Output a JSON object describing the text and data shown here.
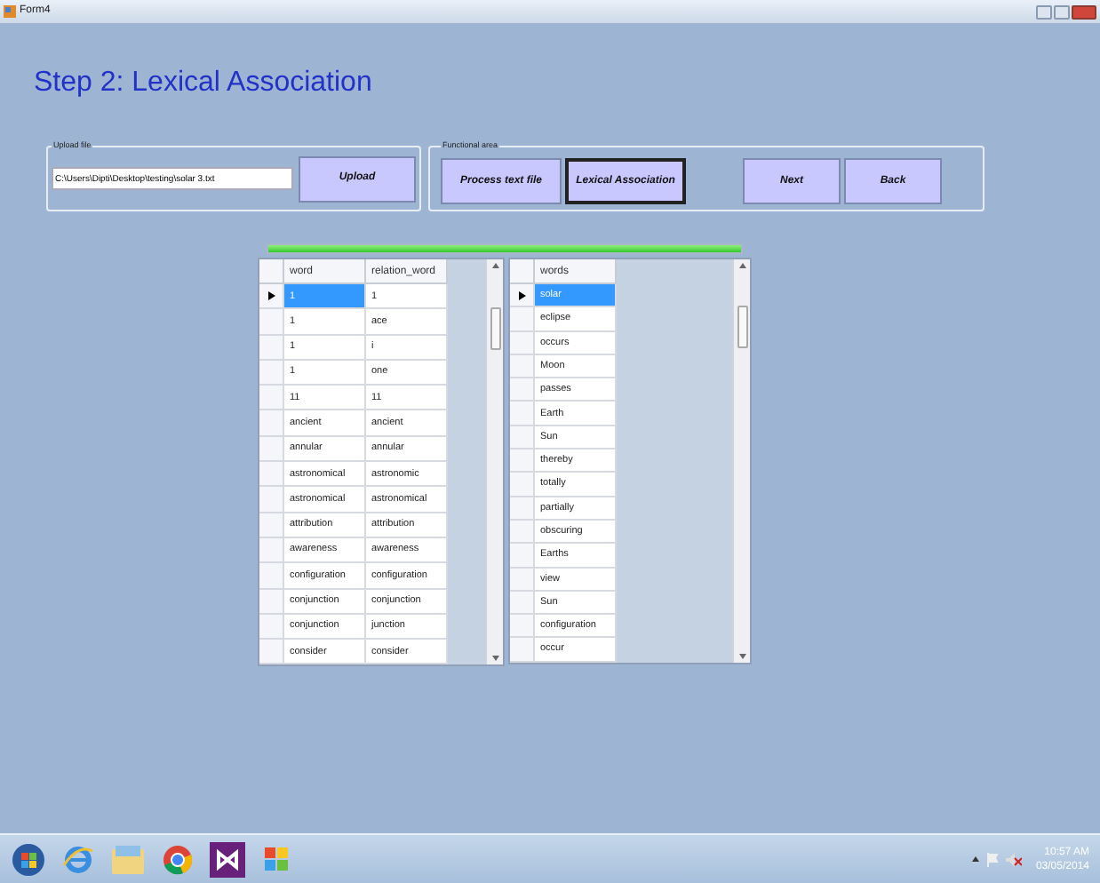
{
  "window": {
    "title": "Form4"
  },
  "heading": "Step 2:  Lexical Association",
  "upload_group": {
    "label": "Upload file",
    "path": "C:\\Users\\Dipti\\Desktop\\testing\\solar 3.txt",
    "button": "Upload"
  },
  "functional_group": {
    "label": "Functional area",
    "buttons": [
      {
        "label": "Process text file",
        "selected": false
      },
      {
        "label": "Lexical Association",
        "selected": true
      },
      {
        "label": "Next",
        "selected": false
      },
      {
        "label": "Back",
        "selected": false
      }
    ]
  },
  "progress": {
    "level": 1
  },
  "left_table": {
    "columns": [
      "word",
      "relation_word"
    ],
    "rows": [
      {
        "cells": [
          "1",
          "1"
        ],
        "selected": true
      },
      {
        "cells": [
          "1",
          "ace"
        ],
        "selected": false
      },
      {
        "cells": [
          "1",
          "i"
        ],
        "selected": false
      },
      {
        "cells": [
          "1",
          "one"
        ],
        "selected": false
      },
      {
        "cells": [
          "11",
          "11"
        ],
        "selected": false
      },
      {
        "cells": [
          "ancient",
          "ancient"
        ],
        "selected": false
      },
      {
        "cells": [
          "annular",
          "annular"
        ],
        "selected": false
      },
      {
        "cells": [
          "astronomical",
          "astronomic"
        ],
        "selected": false
      },
      {
        "cells": [
          "astronomical",
          "astronomical"
        ],
        "selected": false
      },
      {
        "cells": [
          "attribution",
          "attribution"
        ],
        "selected": false
      },
      {
        "cells": [
          "awareness",
          "awareness"
        ],
        "selected": false
      },
      {
        "cells": [
          "configuration",
          "configuration"
        ],
        "selected": false
      },
      {
        "cells": [
          "conjunction",
          "conjunction"
        ],
        "selected": false
      },
      {
        "cells": [
          "conjunction",
          "junction"
        ],
        "selected": false
      },
      {
        "cells": [
          "consider",
          "consider"
        ],
        "selected": false
      }
    ]
  },
  "right_table": {
    "columns": [
      "words"
    ],
    "rows": [
      {
        "cells": [
          "solar"
        ],
        "selected": true
      },
      {
        "cells": [
          "eclipse"
        ],
        "selected": false
      },
      {
        "cells": [
          "occurs"
        ],
        "selected": false
      },
      {
        "cells": [
          "Moon"
        ],
        "selected": false
      },
      {
        "cells": [
          "passes"
        ],
        "selected": false
      },
      {
        "cells": [
          "Earth"
        ],
        "selected": false
      },
      {
        "cells": [
          "Sun"
        ],
        "selected": false
      },
      {
        "cells": [
          "thereby"
        ],
        "selected": false
      },
      {
        "cells": [
          "totally"
        ],
        "selected": false
      },
      {
        "cells": [
          "partially"
        ],
        "selected": false
      },
      {
        "cells": [
          "obscuring"
        ],
        "selected": false
      },
      {
        "cells": [
          "Earths"
        ],
        "selected": false
      },
      {
        "cells": [
          "view"
        ],
        "selected": false
      },
      {
        "cells": [
          "Sun"
        ],
        "selected": false
      },
      {
        "cells": [
          "configuration"
        ],
        "selected": false
      },
      {
        "cells": [
          "occur"
        ],
        "selected": false
      }
    ]
  },
  "taskbar": {
    "time": "10:57 AM",
    "date": "03/05/2014"
  }
}
